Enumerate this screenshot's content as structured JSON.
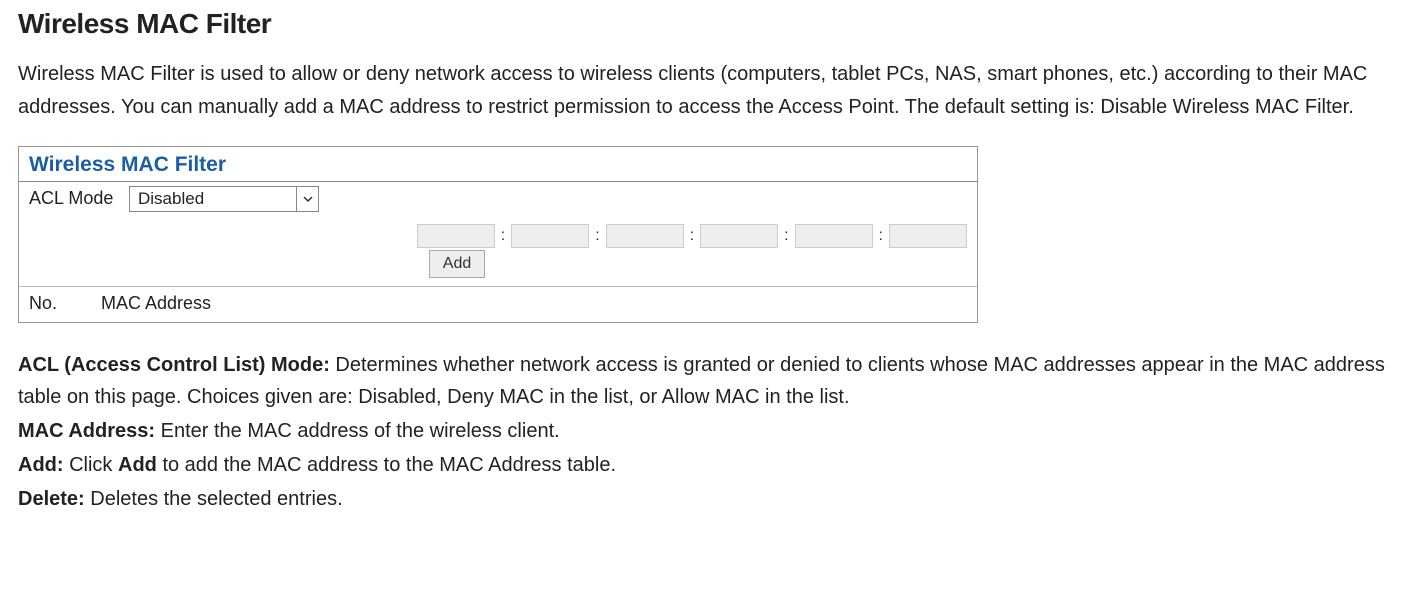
{
  "heading": "Wireless MAC Filter",
  "intro": "Wireless MAC Filter is used to allow or deny network access to wireless clients (computers, tablet PCs, NAS, smart phones, etc.) according to their MAC addresses. You can manually add a MAC address to restrict permission to access the Access Point. The default setting is: Disable Wireless MAC Filter.",
  "panel": {
    "title": "Wireless MAC Filter",
    "acl_label": "ACL Mode",
    "acl_value": "Disabled",
    "add_label": "Add",
    "col_no": "No.",
    "col_mac": "MAC Address"
  },
  "defs": {
    "acl_label": "ACL (Access Control List) Mode:",
    "acl_text": " Determines whether network access is granted or denied to clients whose MAC addresses appear in the MAC address table on this page. Choices given are: Disabled, Deny MAC in the list, or Allow MAC in the list.",
    "mac_label": "MAC Address:",
    "mac_text": " Enter the MAC address of the wireless client.",
    "add_label": "Add:",
    "add_text_pre": " Click ",
    "add_bold": "Add",
    "add_text_post": " to add the MAC address to the MAC Address table.",
    "del_label": "Delete:",
    "del_text": " Deletes the selected entries."
  }
}
